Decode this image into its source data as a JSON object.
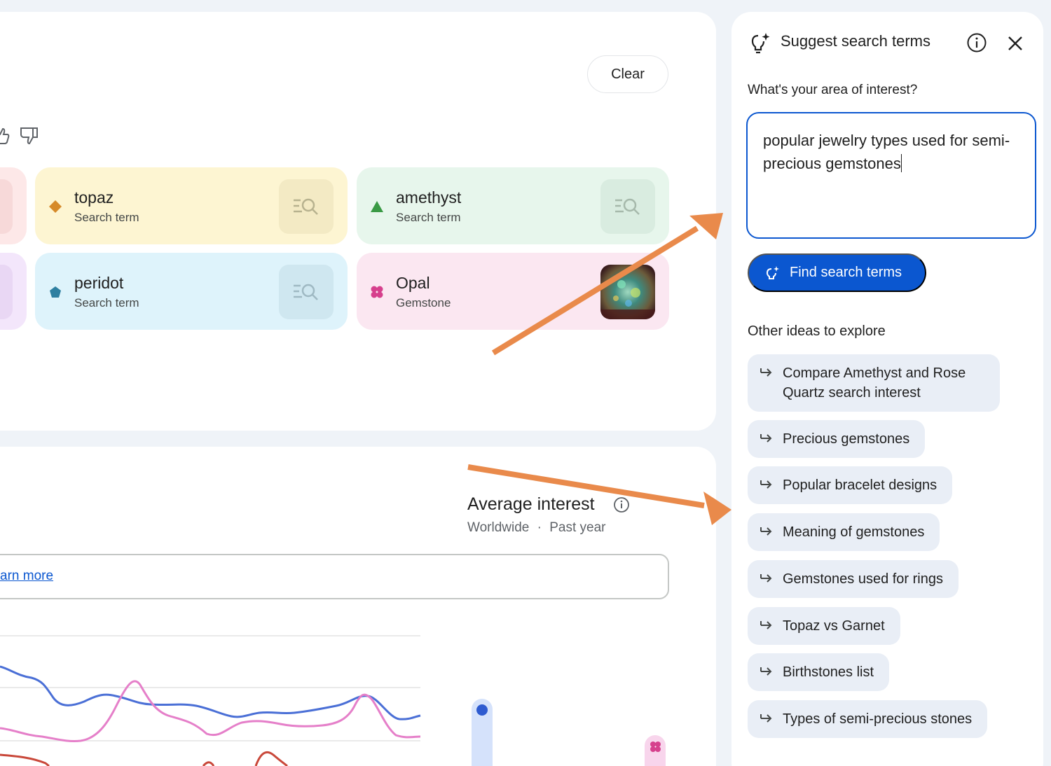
{
  "toolbar": {
    "clear_label": "Clear"
  },
  "chips": [
    {
      "title": "topaz",
      "subtitle": "Search term",
      "bg": "#fdf5d2",
      "marker_color": "#d68a2a",
      "marker": "diamond"
    },
    {
      "title": "amethyst",
      "subtitle": "Search term",
      "bg": "#e7f6ec",
      "marker_color": "#3a9a45",
      "marker": "triangle"
    },
    {
      "title": "peridot",
      "subtitle": "Search term",
      "bg": "#def3fb",
      "marker_color": "#2e7fa1",
      "marker": "pentagon"
    },
    {
      "title": "Opal",
      "subtitle": "Gemstone",
      "bg": "#fbe7f1",
      "marker_color": "#d6408d",
      "marker": "flower"
    }
  ],
  "average": {
    "title": "Average interest",
    "location": "Worldwide",
    "separator": "·",
    "period": "Past year",
    "learn_more": "arn more"
  },
  "panel": {
    "title": "Suggest search terms",
    "question": "What's your area of interest?",
    "query": "popular jewelry types used for semi-precious gemstones",
    "find_label": "Find search terms",
    "other_title": "Other ideas to explore",
    "ideas": [
      "Compare Amethyst and Rose Quartz search interest",
      "Precious gemstones",
      "Popular bracelet designs",
      "Meaning of gemstones",
      "Gemstones used for rings",
      "Topaz vs Garnet",
      "Birthstones list",
      "Types of semi-precious stones"
    ]
  },
  "colors": {
    "accent": "#0b57d0",
    "annotation_arrow": "#e98a4b",
    "series_blue": "#4a6fd6",
    "series_pink": "#e57fc9",
    "series_red": "#c9483a"
  },
  "icons": [
    "thumbs-up-icon",
    "thumbs-down-icon",
    "explore-search-icon",
    "lightbulb-sparkle-icon",
    "info-icon",
    "close-icon",
    "reply-arrow-icon"
  ]
}
